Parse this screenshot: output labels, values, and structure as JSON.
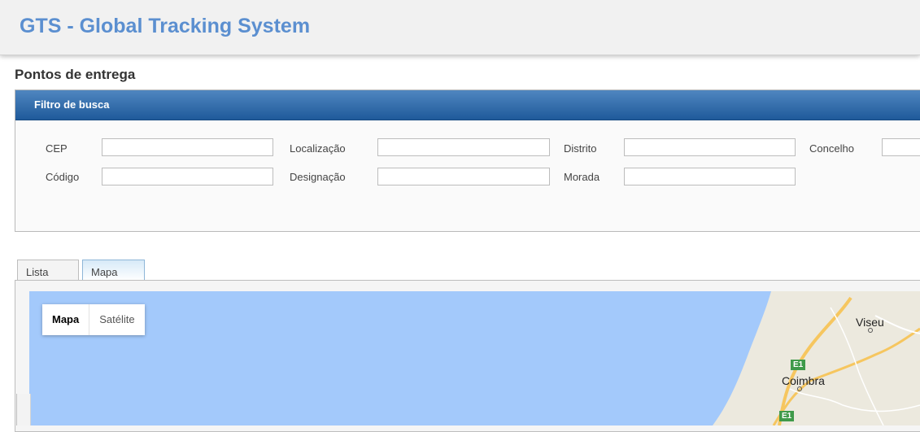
{
  "header": {
    "title": "GTS - Global Tracking System"
  },
  "page": {
    "title": "Pontos de entrega"
  },
  "filter": {
    "title": "Filtro de busca",
    "fields": [
      {
        "label": "CEP",
        "value": ""
      },
      {
        "label": "Localização",
        "value": ""
      },
      {
        "label": "Distrito",
        "value": ""
      },
      {
        "label": "Concelho",
        "value": ""
      },
      {
        "label": "Código",
        "value": ""
      },
      {
        "label": "Designação",
        "value": ""
      },
      {
        "label": "Morada",
        "value": ""
      }
    ]
  },
  "tabs": [
    {
      "label": "Lista",
      "active": false
    },
    {
      "label": "Mapa",
      "active": true
    }
  ],
  "map": {
    "type_buttons": [
      {
        "label": "Mapa",
        "selected": true
      },
      {
        "label": "Satélite",
        "selected": false
      }
    ],
    "places": [
      "Viseu",
      "Coimbra"
    ],
    "road_labels": [
      "E1",
      "E1"
    ],
    "colors": {
      "sea": "#a3c9fb",
      "land": "#ede9df",
      "road": "#f6c65f",
      "accent": "#5b8fd0"
    }
  }
}
